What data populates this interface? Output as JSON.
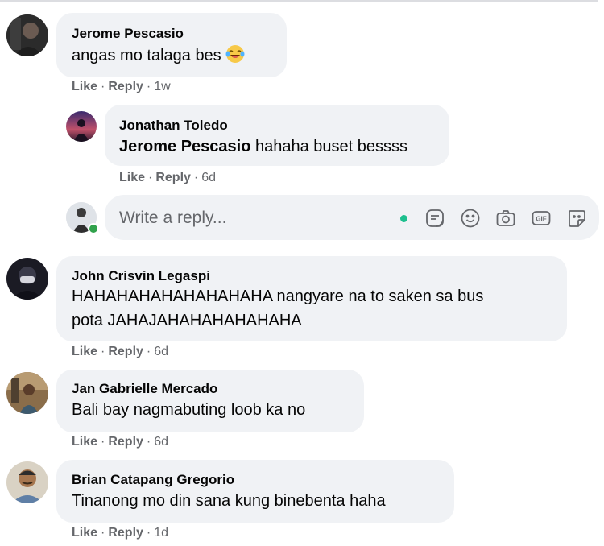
{
  "colors": {
    "bubble": "#f0f2f5",
    "meta": "#65676b",
    "online": "#31a24c",
    "typing_dot": "#1dbf8e"
  },
  "comments": [
    {
      "author": "Jerome Pescasio",
      "text": "angas mo talaga bes",
      "emoji": "laughing-crying-emoji",
      "like": "Like",
      "reply": "Reply",
      "time": "1w"
    },
    {
      "author": "Jonathan Toledo",
      "mention": "Jerome Pescasio",
      "text": "hahaha buset bessss",
      "like": "Like",
      "reply": "Reply",
      "time": "6d"
    },
    {
      "author": "John Crisvin Legaspi",
      "text_line1": "HAHAHAHAHAHAHAHAHA nangyare na to saken sa bus",
      "text_line2": "pota JAHAJAHAHAHAHAHAHA",
      "like": "Like",
      "reply": "Reply",
      "time": "6d"
    },
    {
      "author": "Jan Gabrielle Mercado",
      "text": "Bali bay nagmabuting loob ka no",
      "like": "Like",
      "reply": "Reply",
      "time": "6d"
    },
    {
      "author": "Brian Catapang Gregorio",
      "text": "Tinanong mo din sana kung binebenta haha",
      "like": "Like",
      "reply": "Reply",
      "time": "1d"
    }
  ],
  "reply_box": {
    "placeholder": "Write a reply...",
    "icons": [
      "sticker-icon",
      "emoji-icon",
      "camera-icon",
      "gif-icon",
      "avatar-sticker-icon"
    ]
  },
  "gif_label": "GIF"
}
